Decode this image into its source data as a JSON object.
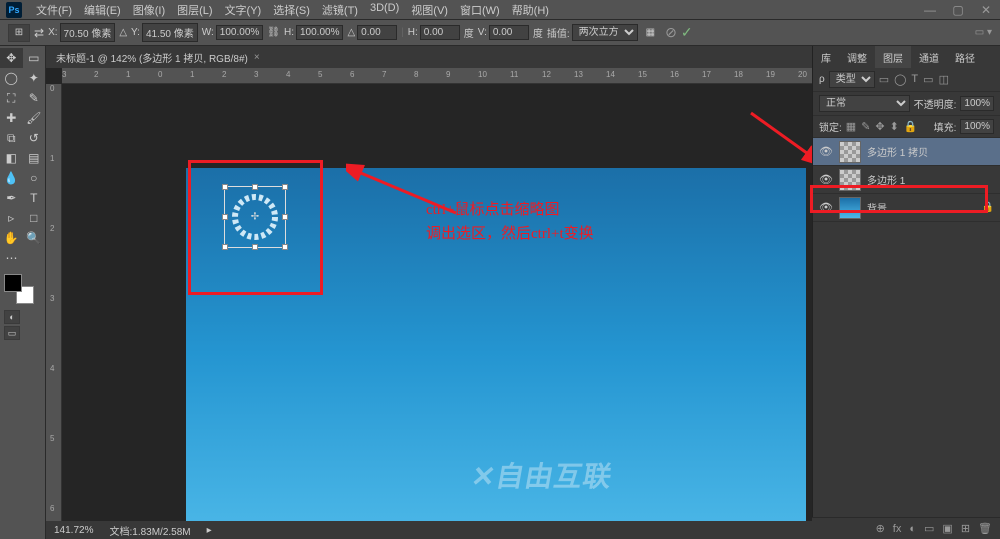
{
  "menu": {
    "items": [
      "文件(F)",
      "编辑(E)",
      "图像(I)",
      "图层(L)",
      "文字(Y)",
      "选择(S)",
      "滤镜(T)",
      "3D(D)",
      "视图(V)",
      "窗口(W)",
      "帮助(H)"
    ]
  },
  "optbar": {
    "x_label": "X:",
    "x_val": "70.50 像素",
    "y_label": "Y:",
    "y_val": "41.50 像素",
    "w_label": "W:",
    "w_val": "100.00%",
    "h_label": "H:",
    "h_val": "100.00%",
    "angle_glyph": "△",
    "angle_val": "0.00",
    "skewh_label": "H:",
    "skewh_val": "0.00",
    "deg1": "度",
    "skewv_label": "V:",
    "skewv_val": "0.00",
    "deg2": "度",
    "interp_label": "插值:",
    "interp_val": "两次立方"
  },
  "doc": {
    "title": "未标题-1 @ 142% (多边形 1 拷贝, RGB/8#)"
  },
  "annotation": {
    "line1": "ctrl+鼠标点击缩略图",
    "line2": "调出选区，然后ctrl+t变换"
  },
  "status": {
    "zoom": "141.72%",
    "docinfo": "文档:1.83M/2.58M"
  },
  "panels": {
    "tabs": [
      "库",
      "调整",
      "图层",
      "通道",
      "路径"
    ],
    "filter_kind": "类型",
    "filter_search": "ρ",
    "row_icons_unicode": [
      "▭",
      "◯",
      "T",
      "▭",
      "◫"
    ],
    "blend": "正常",
    "opacity_label": "不透明度:",
    "opacity_val": "100%",
    "lock_label": "锁定:",
    "fill_label": "填充:",
    "fill_val": "100%",
    "lock_icons": [
      "▦",
      "✎",
      "✥",
      "⬍",
      "🔒"
    ]
  },
  "layers": [
    {
      "name": "多边形 1 拷贝",
      "thumb": "checker",
      "selected": true,
      "locked": false
    },
    {
      "name": "多边形 1",
      "thumb": "checker",
      "selected": false,
      "locked": false
    },
    {
      "name": "背景",
      "thumb": "grad",
      "selected": false,
      "locked": true
    }
  ],
  "ruler_h": [
    "3",
    "2",
    "1",
    "0",
    "1",
    "2",
    "3",
    "4",
    "5",
    "6",
    "7",
    "8",
    "9",
    "10",
    "11",
    "12",
    "13",
    "14",
    "15",
    "16",
    "17",
    "18",
    "19",
    "20"
  ],
  "ruler_v": [
    "0",
    "1",
    "2",
    "3",
    "4",
    "5",
    "6"
  ],
  "watermark": {
    "text": "自由互联"
  },
  "footer_icons": [
    "⊕",
    "fx",
    "◐",
    "▭",
    "▣",
    "⊞",
    "🗑"
  ]
}
